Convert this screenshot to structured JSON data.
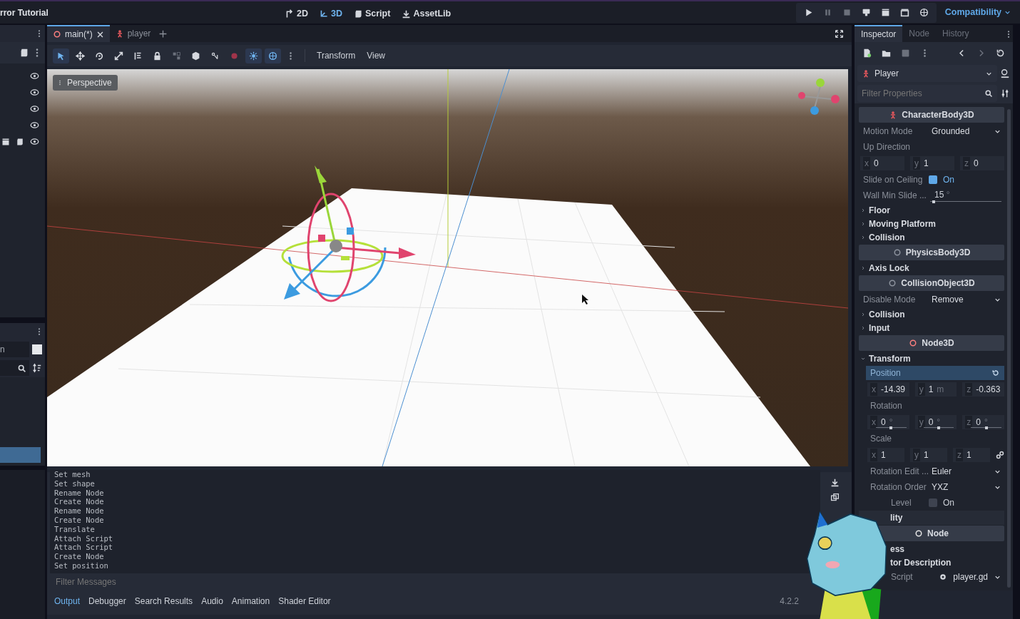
{
  "title_bar": {
    "title": "rror Tutorial"
  },
  "workspaces": [
    {
      "label": "2D",
      "selected": false
    },
    {
      "label": "3D",
      "selected": true
    },
    {
      "label": "Script",
      "selected": false
    },
    {
      "label": "AssetLib",
      "selected": false
    }
  ],
  "renderer": "Compatibility",
  "scene_tabs": [
    {
      "label": "main(*)",
      "selected": true
    },
    {
      "label": "player",
      "selected": false
    }
  ],
  "tools": [
    {
      "selected": true
    },
    {
      "selected": false
    },
    {
      "selected": false
    },
    {
      "selected": false
    },
    {
      "selected": false
    },
    {
      "selected": false
    },
    {
      "selected": false
    },
    {
      "selected": false
    },
    {
      "selected": false
    },
    {
      "selected": false
    },
    {
      "selected": true
    },
    {
      "selected": true
    }
  ],
  "viewport_menus": [
    "Transform",
    "View"
  ],
  "viewport": {
    "view_menu": "Perspective"
  },
  "scene_tree": [
    {
      "visible": true
    },
    {
      "visible": true
    },
    {
      "visible": true
    },
    {
      "visible": true
    },
    {
      "visible": true
    }
  ],
  "filesystem": {
    "field_value": "n"
  },
  "inspector": {
    "tabs": [
      {
        "label": "Inspector",
        "selected": true
      },
      {
        "label": "Node",
        "selected": false
      },
      {
        "label": "History",
        "selected": false
      }
    ],
    "object": "Player",
    "filter_placeholder": "Filter Properties",
    "properties": [
      {
        "kind": "class",
        "label": "CharacterBody3D",
        "color": "#e0565b"
      },
      {
        "kind": "enum",
        "label": "Motion Mode",
        "value": "Grounded"
      },
      {
        "kind": "label",
        "label": "Up Direction"
      },
      {
        "kind": "vector",
        "components": [
          {
            "axis": "x",
            "value": "0"
          },
          {
            "axis": "y",
            "value": "1"
          },
          {
            "axis": "z",
            "value": "0"
          }
        ]
      },
      {
        "kind": "check",
        "label": "Slide on Ceiling",
        "checked": true,
        "text": "On"
      },
      {
        "kind": "slider",
        "label": "Wall Min Slide ...",
        "value": "15",
        "unit": "°",
        "level": 0.05
      },
      {
        "kind": "group",
        "label": "Floor",
        "expanded": false
      },
      {
        "kind": "group",
        "label": "Moving Platform",
        "expanded": false
      },
      {
        "kind": "group",
        "label": "Collision",
        "expanded": false
      },
      {
        "kind": "class",
        "label": "PhysicsBody3D",
        "color": "#8d939e"
      },
      {
        "kind": "group",
        "label": "Axis Lock",
        "expanded": false
      },
      {
        "kind": "class",
        "label": "CollisionObject3D",
        "color": "#8d939e"
      },
      {
        "kind": "enum",
        "label": "Disable Mode",
        "value": "Remove"
      },
      {
        "kind": "group",
        "label": "Collision",
        "expanded": false
      },
      {
        "kind": "group",
        "label": "Input",
        "expanded": false
      },
      {
        "kind": "class",
        "label": "Node3D",
        "color": "#fc7f7f"
      },
      {
        "kind": "group",
        "label": "Transform",
        "expanded": true,
        "children": [
          {
            "kind": "label",
            "label": "Position",
            "selected": true
          },
          {
            "kind": "vector",
            "components": [
              {
                "axis": "x",
                "value": "-14.39"
              },
              {
                "axis": "y",
                "value": "1",
                "unit": "m"
              },
              {
                "axis": "z",
                "value": "-0.363"
              }
            ]
          },
          {
            "kind": "label",
            "label": "Rotation",
            "selected": false
          },
          {
            "kind": "vector",
            "components": [
              {
                "axis": "x",
                "value": "0",
                "unit": "°",
                "level": 0.5
              },
              {
                "axis": "y",
                "value": "0",
                "unit": "°",
                "level": 0.5
              },
              {
                "axis": "z",
                "value": "0",
                "unit": "°",
                "level": 0.5
              }
            ]
          },
          {
            "kind": "label",
            "label": "Scale",
            "selected": false
          },
          {
            "kind": "vector",
            "linked": true,
            "components": [
              {
                "axis": "x",
                "value": "1"
              },
              {
                "axis": "y",
                "value": "1"
              },
              {
                "axis": "z",
                "value": "1"
              }
            ]
          },
          {
            "kind": "enum",
            "label": "Rotation Edit ...",
            "value": "Euler"
          },
          {
            "kind": "enum",
            "label": "Rotation Order",
            "value": "YXZ"
          },
          {
            "kind": "check",
            "label": "Level",
            "checked": false,
            "text": "On",
            "partial": true
          }
        ]
      },
      {
        "kind": "subgroup",
        "label": "lity",
        "partial": true
      },
      {
        "kind": "class",
        "label": "Node",
        "color": "#e6e6e6"
      },
      {
        "kind": "group",
        "label": "ess",
        "partial": true
      },
      {
        "kind": "group",
        "label": "tor Description",
        "partial": true
      },
      {
        "kind": "resource",
        "label": "Script",
        "value": "player.gd",
        "partial": true
      }
    ]
  },
  "output": {
    "lines": [
      "Set mesh",
      "Set shape",
      "Rename Node",
      "Create Node",
      "Rename Node",
      "Create Node",
      "Translate",
      "Attach Script",
      "Attach Script",
      "Create Node",
      "Set position"
    ],
    "filter_placeholder": "Filter Messages"
  },
  "bottom_tabs": [
    {
      "label": "Output",
      "selected": true
    },
    {
      "label": "Debugger",
      "selected": false
    },
    {
      "label": "Search Results",
      "selected": false
    },
    {
      "label": "Audio",
      "selected": false
    },
    {
      "label": "Animation",
      "selected": false
    },
    {
      "label": "Shader Editor",
      "selected": false
    }
  ],
  "version": "4.2.2"
}
